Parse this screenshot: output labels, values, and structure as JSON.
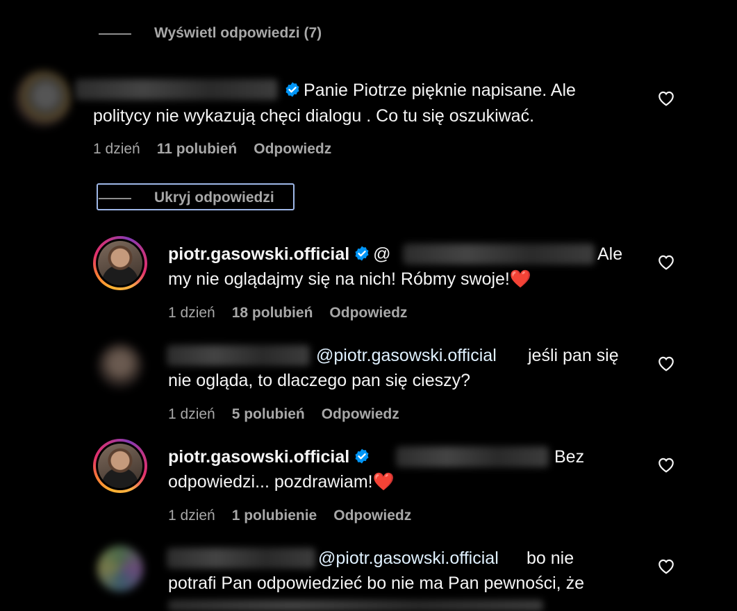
{
  "view_replies": "Wyświetl odpowiedzi (7)",
  "hide_replies": "Ukryj odpowiedzi",
  "comments": [
    {
      "username": "",
      "verified": true,
      "line1": "Panie Piotrze pięknie napisane. Ale",
      "line2": "politycy nie wykazują chęci dialogu . Co tu się oszukiwać.",
      "time": "1 dzień",
      "likes": "11 polubień",
      "reply": "Odpowiedz"
    },
    {
      "username": "piotr.gasowski.official",
      "verified": true,
      "mention_prefix": "@",
      "line1_end": "Ale",
      "line2": "my nie oglądajmy się na nich! Róbmy swoje!❤️",
      "time": "1 dzień",
      "likes": "18 polubień",
      "reply": "Odpowiedz"
    },
    {
      "username": "",
      "mention": "@piotr.gasowski.official",
      "line1_end": "jeśli pan się",
      "line2": "nie ogląda, to dlaczego pan się cieszy?",
      "time": "1 dzień",
      "likes": "5 polubień",
      "reply": "Odpowiedz"
    },
    {
      "username": "piotr.gasowski.official",
      "verified": true,
      "line1_end": "Bez",
      "line2": "odpowiedzi... pozdrawiam!❤️",
      "time": "1 dzień",
      "likes": "1 polubienie",
      "reply": "Odpowiedz"
    },
    {
      "username": "",
      "mention": "@piotr.gasowski.official",
      "line1_end": "bo nie",
      "line2": "potrafi Pan odpowiedzieć bo nie ma Pan pewności, że"
    }
  ],
  "colors": {
    "background": "#000000",
    "text": "#f5f5f5",
    "muted": "#a8a8a8",
    "verified": "#0095f6",
    "focus": "#9fb8e8"
  },
  "icons": [
    "verified-badge-icon",
    "heart-outline-icon"
  ]
}
